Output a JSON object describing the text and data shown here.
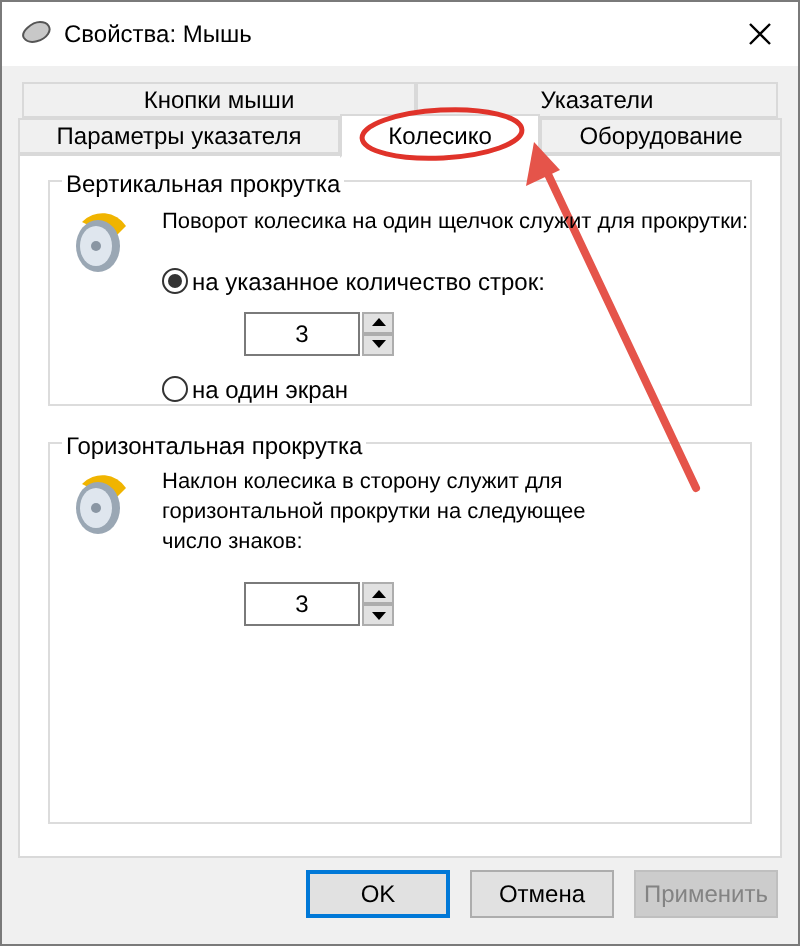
{
  "window": {
    "title": "Свойства: Мышь"
  },
  "tab_rows": [
    [
      {
        "label": "Кнопки мыши",
        "selected": false
      },
      {
        "label": "Указатели",
        "selected": false
      }
    ],
    [
      {
        "label": "Параметры указателя",
        "selected": false
      },
      {
        "label": "Колесико",
        "selected": true
      },
      {
        "label": "Оборудование",
        "selected": false
      }
    ]
  ],
  "vertical_scrolling": {
    "title": "Вертикальная прокрутка",
    "description": "Поворот колесика на один щелчок служит для прокрутки:",
    "options": [
      {
        "label": "на указанное количество строк:",
        "selected": true
      },
      {
        "label": "на один экран",
        "selected": false
      }
    ],
    "spinner": "3"
  },
  "horizontal_scrolling": {
    "title": "Горизонтальная прокрутка",
    "description": "Наклон колесика в сторону служит для горизонтальной прокрутки на следующее число знаков:",
    "spinner": "3"
  },
  "buttons": [
    {
      "label": "OK",
      "default": true,
      "disabled": false
    },
    {
      "label": "Отмена",
      "default": false,
      "disabled": false
    },
    {
      "label": "Применить",
      "default": false,
      "disabled": true
    }
  ]
}
